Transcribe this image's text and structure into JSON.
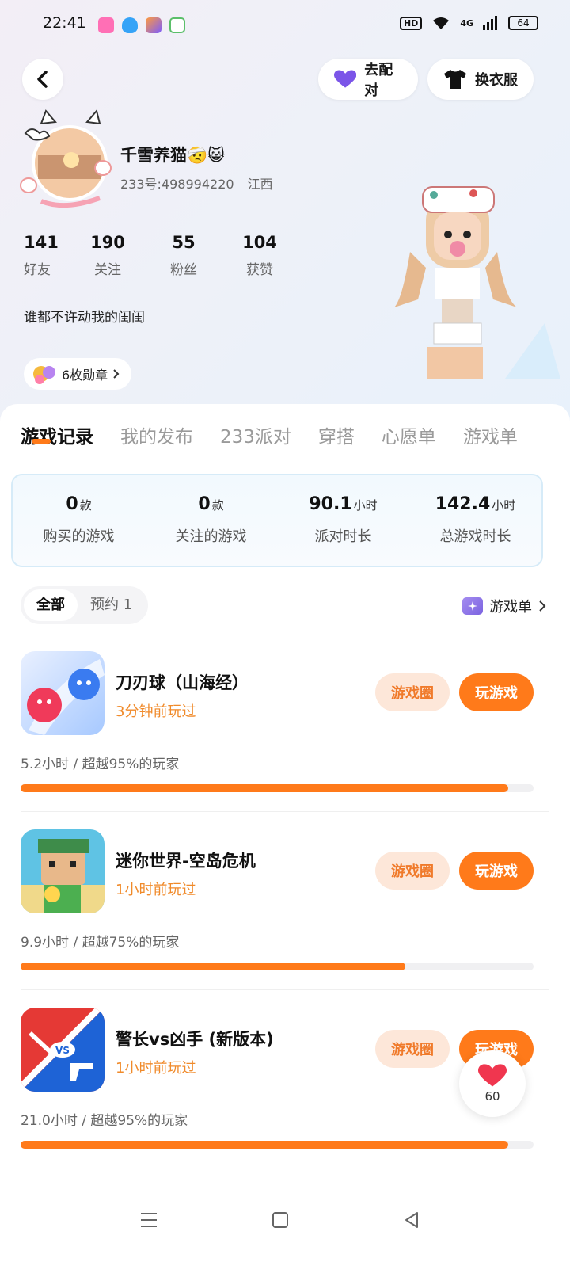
{
  "status_bar": {
    "time": "22:41",
    "network": "4G",
    "hd": "HD",
    "battery": "64"
  },
  "header": {
    "match_label": "去配对",
    "dress_label": "换衣服"
  },
  "profile": {
    "nickname": "千雪养猫🤕😺",
    "uid": "233号:498994220",
    "region": "江西",
    "bio": "谁都不许动我的闺闺",
    "medals": "6枚勋章",
    "stats": [
      {
        "value": "141",
        "label": "好友"
      },
      {
        "value": "190",
        "label": "关注"
      },
      {
        "value": "55",
        "label": "粉丝"
      },
      {
        "value": "104",
        "label": "获赞"
      }
    ]
  },
  "tabs": [
    "游戏记录",
    "我的发布",
    "233派对",
    "穿搭",
    "心愿单",
    "游戏单"
  ],
  "summary": [
    {
      "value": "0",
      "unit": "款",
      "label": "购买的游戏"
    },
    {
      "value": "0",
      "unit": "款",
      "label": "关注的游戏"
    },
    {
      "value": "90.1",
      "unit": "小时",
      "label": "派对时长"
    },
    {
      "value": "142.4",
      "unit": "小时",
      "label": "总游戏时长"
    }
  ],
  "filter": {
    "all": "全部",
    "reserve": "预约 1",
    "game_list": "游戏单"
  },
  "games": [
    {
      "title": "刀刃球（山海经）",
      "played": "3分钟前玩过",
      "stat": "5.2小时 / 超越95%的玩家",
      "progress": 95,
      "circle": "游戏圈",
      "play": "玩游戏"
    },
    {
      "title": "迷你世界-空岛危机",
      "played": "1小时前玩过",
      "stat": "9.9小时 / 超越75%的玩家",
      "progress": 75,
      "circle": "游戏圈",
      "play": "玩游戏"
    },
    {
      "title": "警长vs凶手 (新版本)",
      "played": "1小时前玩过",
      "stat": "21.0小时 / 超越95%的玩家",
      "progress": 95,
      "circle": "游戏圈",
      "play": "玩游戏"
    }
  ],
  "like": {
    "count": "60"
  },
  "colors": {
    "accent": "#ff7a1a",
    "accent_light": "#fde7d9",
    "card_border": "#d6ebf8"
  }
}
